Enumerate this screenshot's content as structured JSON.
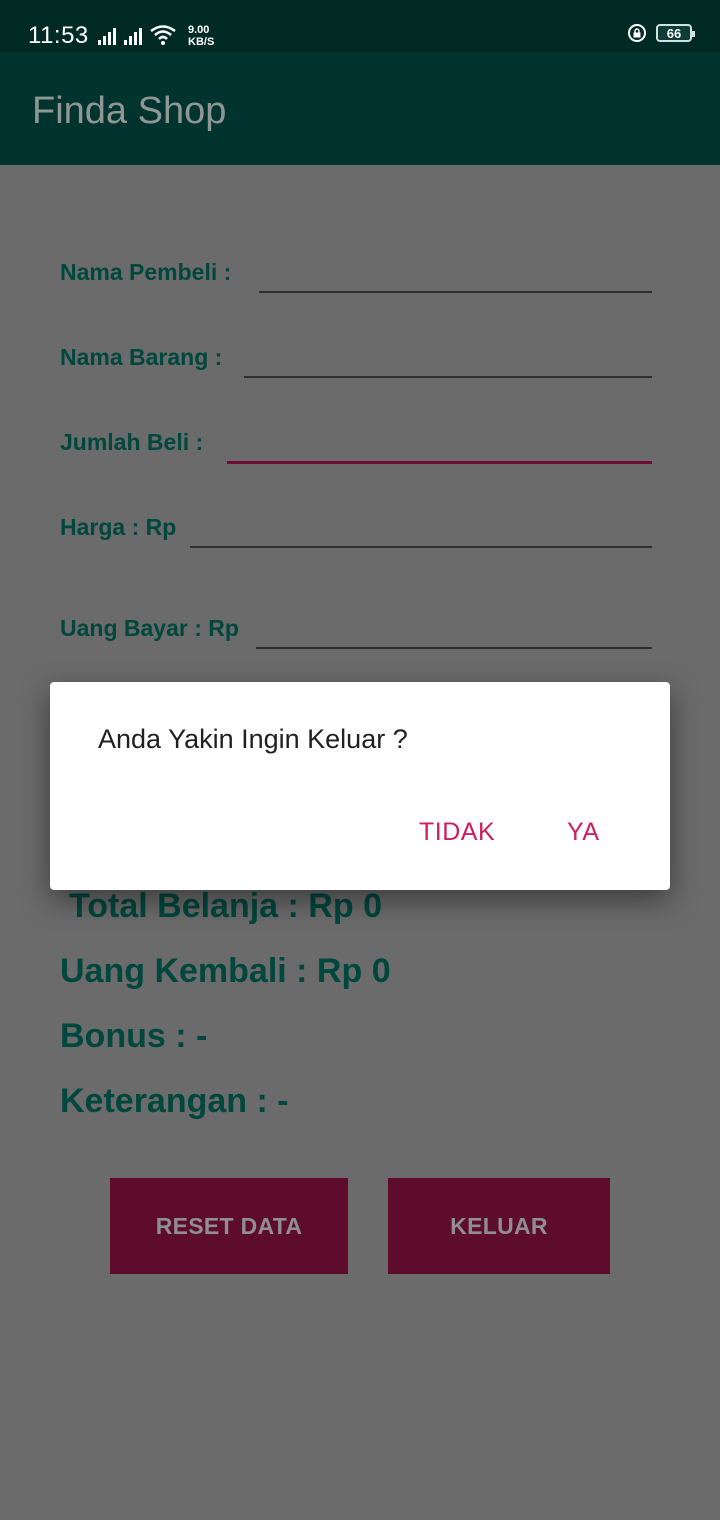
{
  "status_bar": {
    "time": "11:53",
    "net_speed_value": "9.00",
    "net_speed_unit": "KB/S",
    "battery": "66",
    "icons": [
      "signal-icon",
      "signal-icon",
      "wifi-icon",
      "rotation-lock-icon",
      "battery-icon"
    ]
  },
  "app_bar": {
    "title": "Finda Shop"
  },
  "form": {
    "nama_pembeli_label": "Nama Pembeli :",
    "nama_barang_label": "Nama Barang :",
    "jumlah_beli_label": "Jumlah Beli :",
    "harga_label": "Harga : Rp",
    "uang_bayar_label": "Uang Bayar : Rp",
    "nama_pembeli_value": "",
    "nama_barang_value": "",
    "jumlah_beli_value": "",
    "harga_value": "",
    "uang_bayar_value": ""
  },
  "summary": {
    "total_belanja": "Total Belanja : Rp 0",
    "uang_kembali": "Uang Kembali : Rp 0",
    "bonus": "Bonus : -",
    "keterangan": "Keterangan : -"
  },
  "buttons": {
    "reset": "RESET DATA",
    "keluar": "KELUAR"
  },
  "dialog": {
    "message": "Anda Yakin Ingin Keluar ?",
    "negative": "TIDAK",
    "positive": "YA"
  },
  "colors": {
    "status_bar": "#012a24",
    "app_bar": "#01342e",
    "scrim_background": "#6b6b6b",
    "label_text": "#00473d",
    "button_bg": "#5e0c2b",
    "dialog_accent": "#d01c5c",
    "focused_underline": "#6e0e33"
  }
}
